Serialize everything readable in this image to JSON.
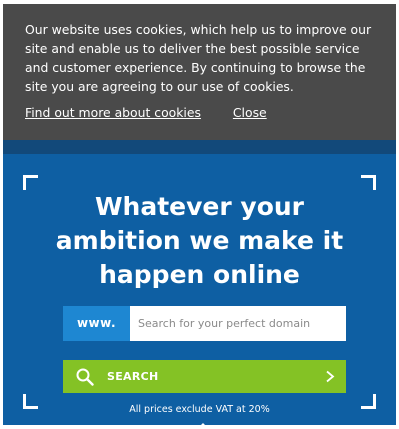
{
  "cookie_banner": {
    "message": "Our website uses cookies, which help us to improve our site and enable us to deliver the best possible service and customer experience. By continuing to browse the site you are agreeing to our use of cookies.",
    "more_link": "Find out more about cookies",
    "close_link": "Close"
  },
  "hero": {
    "headline": "Whatever your ambition we make it happen online",
    "www_prefix": "www.",
    "search_placeholder": "Search for your perfect domain",
    "search_value": "",
    "search_button_label": "SEARCH",
    "vat_note": "All prices exclude VAT at 20%"
  },
  "icons": {
    "search": "search-icon",
    "chevron": "chevron-right-icon"
  },
  "colors": {
    "banner_bg": "#4a4a4a",
    "hero_bg": "#0e5fa3",
    "www_bg": "#1e87d2",
    "search_button_bg": "#84c225"
  }
}
